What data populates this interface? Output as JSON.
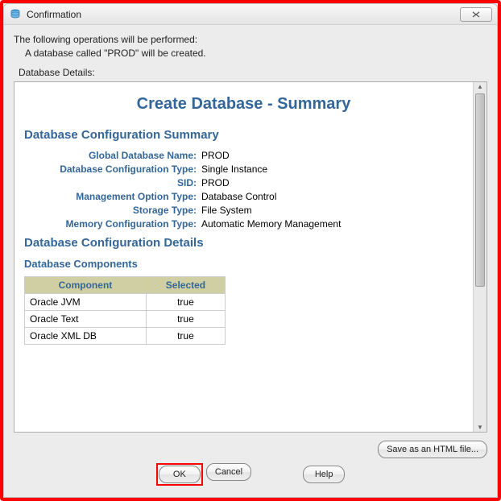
{
  "window": {
    "title": "Confirmation"
  },
  "intro": {
    "line1": "The following operations will be performed:",
    "line2": "A database called \"PROD\" will be created."
  },
  "details_label": "Database Details:",
  "summary": {
    "title": "Create Database - Summary",
    "config_heading": "Database Configuration Summary",
    "rows": {
      "global_db_name": {
        "label": "Global Database Name:",
        "value": "PROD"
      },
      "config_type": {
        "label": "Database Configuration Type:",
        "value": "Single Instance"
      },
      "sid": {
        "label": "SID:",
        "value": "PROD"
      },
      "mgmt_type": {
        "label": "Management Option Type:",
        "value": "Database Control"
      },
      "storage_type": {
        "label": "Storage Type:",
        "value": "File System"
      },
      "mem_type": {
        "label": "Memory Configuration Type:",
        "value": "Automatic Memory Management"
      }
    },
    "details_heading": "Database Configuration Details",
    "components_heading": "Database Components",
    "components_table": {
      "col_component": "Component",
      "col_selected": "Selected",
      "rows": [
        {
          "name": "Oracle JVM",
          "selected": "true"
        },
        {
          "name": "Oracle Text",
          "selected": "true"
        },
        {
          "name": "Oracle XML DB",
          "selected": "true"
        }
      ]
    }
  },
  "buttons": {
    "save_html": "Save as an HTML file...",
    "ok": "OK",
    "cancel": "Cancel",
    "help": "Help"
  }
}
